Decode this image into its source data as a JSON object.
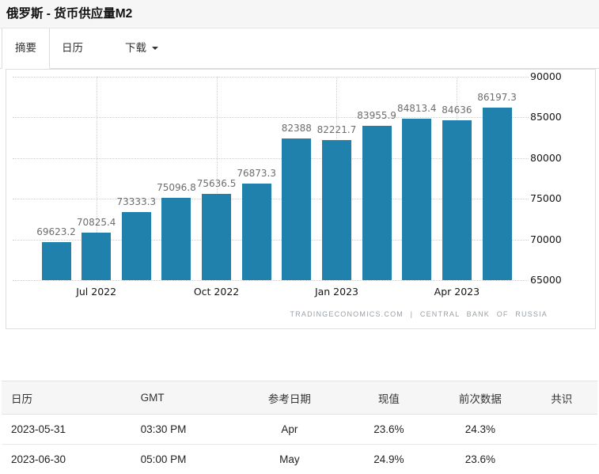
{
  "page": {
    "title": "俄罗斯 - 货币供应量M2"
  },
  "tabs": [
    {
      "label": "摘要",
      "active": true
    },
    {
      "label": "日历",
      "active": false
    },
    {
      "label": "下载",
      "active": false,
      "has_caret": true
    }
  ],
  "chart_data": {
    "type": "bar",
    "title": "俄罗斯 - 货币供应量M2",
    "values": [
      69623.2,
      70825.4,
      73333.3,
      75096.8,
      75636.5,
      76873.3,
      82388,
      82221.7,
      83955.9,
      84813.4,
      84636,
      86197.3
    ],
    "value_labels": [
      "69623.2",
      "70825.4",
      "73333.3",
      "75096.8",
      "75636.5",
      "76873.3",
      "82388",
      "82221.7",
      "83955.9",
      "84813.4",
      "84636",
      "86197.3"
    ],
    "x_ticks": [
      {
        "label": "Jul 2022",
        "bar_index": 1
      },
      {
        "label": "Oct 2022",
        "bar_index": 4
      },
      {
        "label": "Jan 2023",
        "bar_index": 7
      },
      {
        "label": "Apr 2023",
        "bar_index": 10
      }
    ],
    "y_ticks": [
      "90000",
      "85000",
      "80000",
      "75000",
      "70000",
      "65000"
    ],
    "ylim": [
      65000,
      90000
    ],
    "grid": "dotted",
    "legend_position": "none",
    "bar_color": "#2081ad",
    "attribution": "TRADINGECONOMICS.COM | CENTRAL BANK OF RUSSIA"
  },
  "calendar_table": {
    "headers": [
      "日历",
      "GMT",
      "参考日期",
      "现值",
      "前次数据",
      "共识"
    ],
    "rows": [
      {
        "date": "2023-05-31",
        "gmt": "03:30 PM",
        "ref": "Apr",
        "actual": "23.6%",
        "previous": "24.3%",
        "consensus": ""
      },
      {
        "date": "2023-06-30",
        "gmt": "05:00 PM",
        "ref": "May",
        "actual": "24.9%",
        "previous": "23.6%",
        "consensus": ""
      }
    ]
  },
  "colors": {
    "bar": "#2081ad",
    "grid_dot": "#cfcfcf",
    "value_label": "#6d6d6d",
    "attribution_text": "#9aa0a6",
    "header_bg": "#f6f6f6"
  }
}
